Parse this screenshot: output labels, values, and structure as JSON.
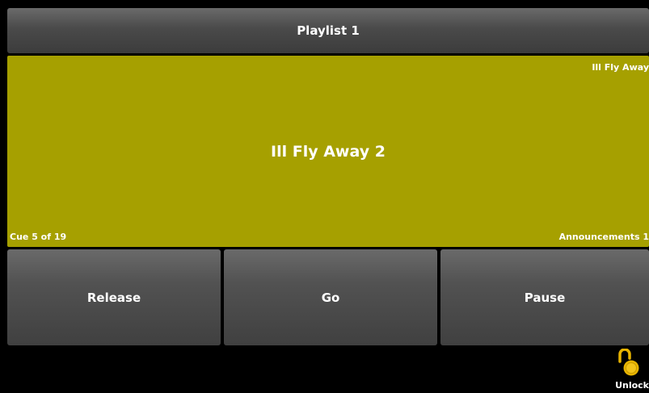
{
  "header": {
    "title": "Playlist 1"
  },
  "cue": {
    "label_small": "Ill Fly Away",
    "label_main": "Ill Fly Away 2",
    "count": "Cue 5 of 19",
    "playlist": "Announcements 1",
    "color": "#a6a000"
  },
  "controls": {
    "release_label": "Release",
    "go_label": "Go",
    "pause_label": "Pause"
  },
  "lock": {
    "label": "Unlock",
    "icon": "unlocked-padlock-icon",
    "color": "#e8b400"
  }
}
